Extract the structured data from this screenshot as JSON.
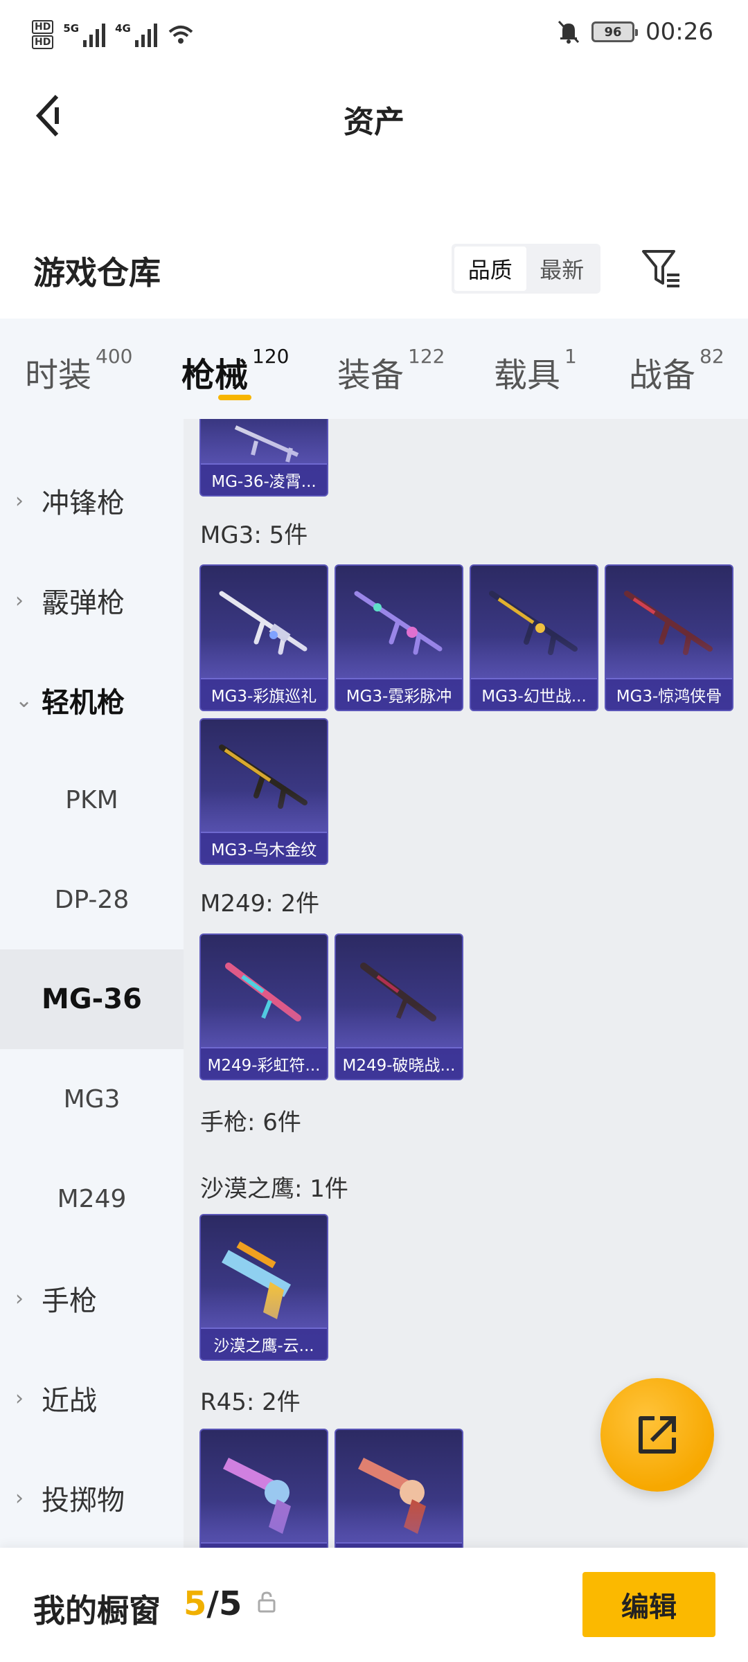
{
  "status": {
    "time": "00:26",
    "battery": "96",
    "net1": "5G",
    "net2": "4G",
    "hd1": "HD",
    "hd2": "HD"
  },
  "header": {
    "title": "资产"
  },
  "warehouse": {
    "title": "游戏仓库",
    "sort_quality": "品质",
    "sort_newest": "最新"
  },
  "tabs": [
    {
      "label": "时装",
      "count": "400"
    },
    {
      "label": "枪械",
      "count": "120"
    },
    {
      "label": "装备",
      "count": "122"
    },
    {
      "label": "载具",
      "count": "1"
    },
    {
      "label": "战备",
      "count": "82"
    }
  ],
  "sidebar": {
    "smg": "冲锋枪",
    "shotgun": "霰弹枪",
    "lmg": "轻机枪",
    "pkm": "PKM",
    "dp28": "DP-28",
    "mg36": "MG-36",
    "mg3": "MG3",
    "m249": "M249",
    "pistol": "手枪",
    "melee": "近战",
    "throwable": "投掷物"
  },
  "groups": {
    "mg3": "MG3: 5件",
    "m249": "M249: 2件",
    "pistol": "手枪: 6件",
    "deagle": "沙漠之鹰: 1件",
    "r45": "R45: 2件"
  },
  "cards": {
    "mg36_1": "MG-36-凌霄...",
    "mg3_1": "MG3-彩旗巡礼",
    "mg3_2": "MG3-霓彩脉冲",
    "mg3_3": "MG3-幻世战...",
    "mg3_4": "MG3-惊鸿侠骨",
    "mg3_5": "MG3-乌木金纹",
    "m249_1": "M249-彩虹符...",
    "m249_2": "M249-破晓战...",
    "deagle_1": "沙漠之鹰-云...",
    "r45_1": "",
    "r45_2": ""
  },
  "bottom": {
    "label": "我的橱窗",
    "count_current": "5",
    "count_sep": "/",
    "count_total": "5",
    "edit": "编辑"
  },
  "colors": {
    "accent": "#f7b500",
    "card_bg": "#3e3b8a",
    "tab_bg": "#f3f6fa"
  }
}
